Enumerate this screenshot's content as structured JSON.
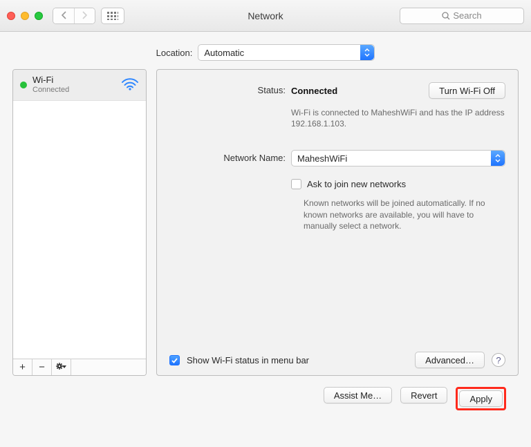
{
  "titlebar": {
    "title": "Network",
    "search_placeholder": "Search"
  },
  "location": {
    "label": "Location:",
    "value": "Automatic"
  },
  "sidebar": {
    "services": [
      {
        "name": "Wi-Fi",
        "status": "Connected",
        "status_color": "#27c13a"
      }
    ],
    "toolbar": {
      "add": "+",
      "remove": "−"
    }
  },
  "detail": {
    "status_label": "Status:",
    "status_value": "Connected",
    "toggle_button": "Turn Wi-Fi Off",
    "status_note": "Wi-Fi is connected to MaheshWiFi and has the IP address 192.168.1.103.",
    "network_name_label": "Network Name:",
    "network_name_value": "MaheshWiFi",
    "ask_join_label": "Ask to join new networks",
    "ask_join_note": "Known networks will be joined automatically. If no known networks are available, you will have to manually select a network.",
    "show_menubar_label": "Show Wi-Fi status in menu bar",
    "advanced_button": "Advanced…"
  },
  "footer": {
    "assist": "Assist Me…",
    "revert": "Revert",
    "apply": "Apply"
  }
}
